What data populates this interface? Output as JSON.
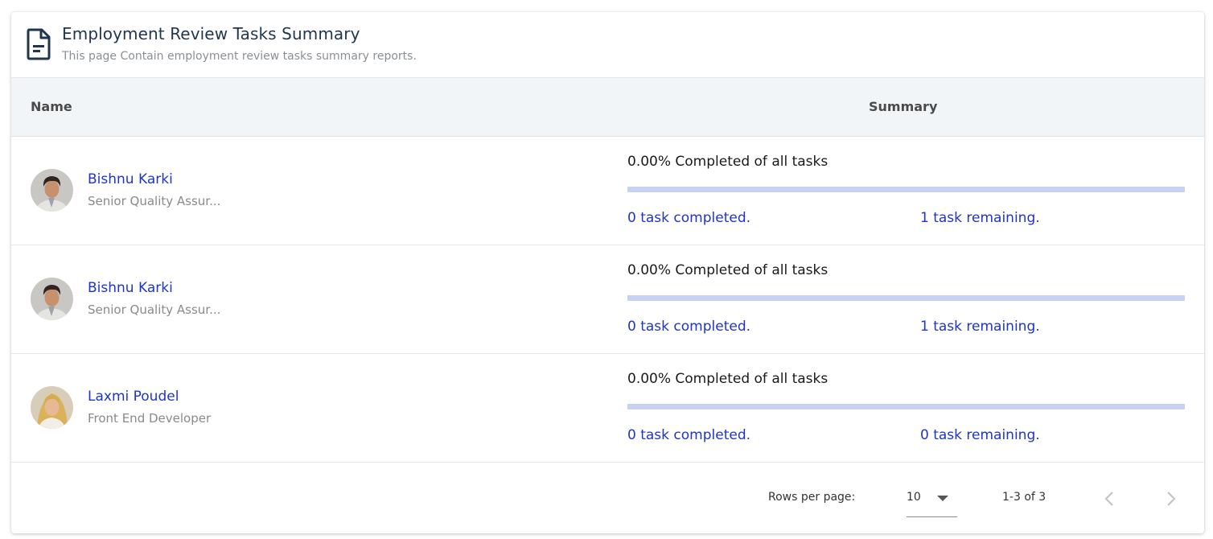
{
  "header": {
    "title": "Employment Review Tasks Summary",
    "subtitle": "This page Contain employment review tasks summary reports.",
    "icon": "document-icon"
  },
  "table": {
    "columns": [
      "Name",
      "Summary"
    ],
    "rows": [
      {
        "name": "Bishnu Karki",
        "role": "Senior Quality Assur...",
        "avatar": "avatar-man",
        "percent_text": "0.00% Completed of all tasks",
        "progress": 0,
        "completed_text": "0 task completed.",
        "remaining_text": "1 task remaining."
      },
      {
        "name": "Bishnu Karki",
        "role": "Senior Quality Assur...",
        "avatar": "avatar-man",
        "percent_text": "0.00% Completed of all tasks",
        "progress": 0,
        "completed_text": "0 task completed.",
        "remaining_text": "1 task remaining."
      },
      {
        "name": "Laxmi Poudel",
        "role": "Front End Developer",
        "avatar": "avatar-woman",
        "percent_text": "0.00% Completed of all tasks",
        "progress": 0,
        "completed_text": "0 task completed.",
        "remaining_text": "0 task remaining."
      }
    ]
  },
  "pagination": {
    "rows_per_page_label": "Rows per page:",
    "rows_per_page_value": "10",
    "range": "1-3 of 3",
    "prev_icon": "chevron-left-icon",
    "next_icon": "chevron-right-icon"
  },
  "colors": {
    "title": "#1f3550",
    "link": "#1e35c8",
    "header_bg": "#f2f5f8",
    "progress_track": "#c9d1f2"
  }
}
